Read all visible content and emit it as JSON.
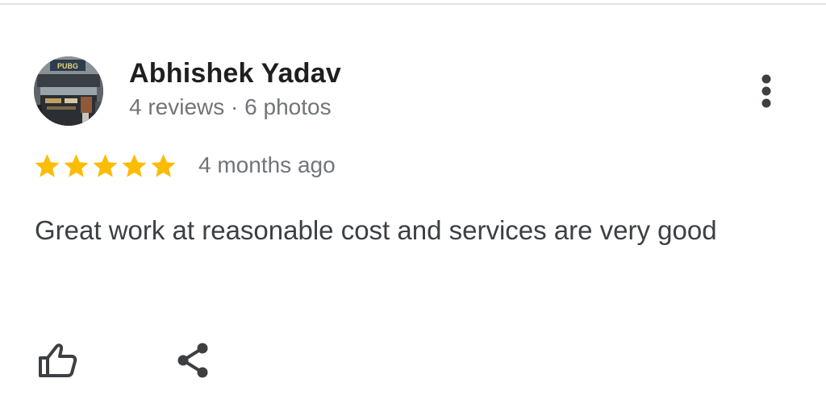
{
  "review": {
    "author_name": "Abhishek Yadav",
    "author_meta": "4 reviews · 6 photos",
    "rating": 5,
    "rating_max": 5,
    "time_ago": "4 months ago",
    "text": "Great work at reasonable cost and services are very good",
    "avatar_sign_text": "PUBG"
  },
  "icons": {
    "more": "more-vert-icon",
    "star": "star-icon",
    "like": "thumb-up-icon",
    "share": "share-icon"
  },
  "colors": {
    "star": "#fbbc04",
    "name": "#1f1f1f",
    "meta": "#70757a",
    "body": "#3c4043",
    "icon": "#3c4043"
  }
}
